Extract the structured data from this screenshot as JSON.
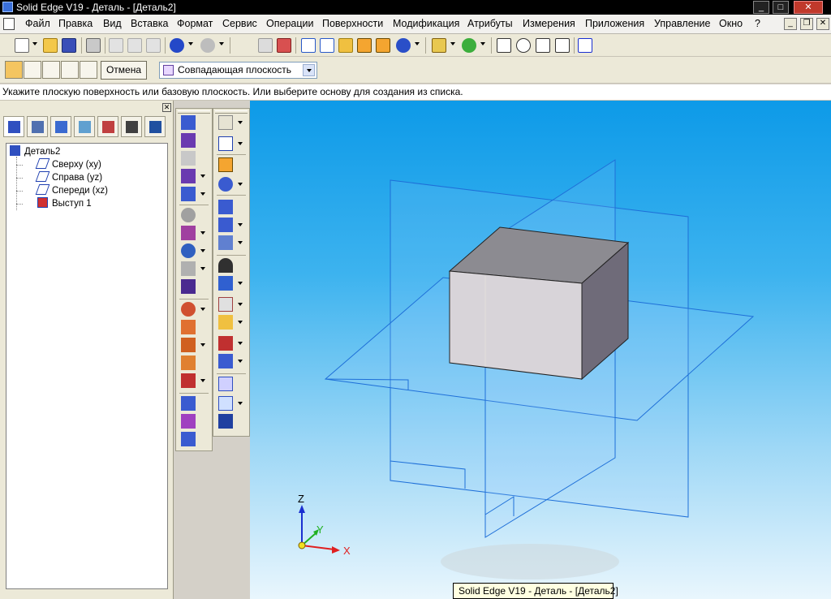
{
  "window": {
    "title": "Solid Edge V19 - Деталь - [Деталь2]",
    "minimize_glyph": "_",
    "restore_glyph": "□",
    "close_glyph": "✕"
  },
  "menu": {
    "items": [
      "Файл",
      "Правка",
      "Вид",
      "Вставка",
      "Формат",
      "Сервис",
      "Операции",
      "Поверхности",
      "Модификация",
      "Атрибуты",
      "Измерения",
      "Приложения",
      "Управление",
      "Окно",
      "?"
    ]
  },
  "toolbar2": {
    "cancel_label": "Отмена",
    "plane_option": "Совпадающая плоскость"
  },
  "prompt": {
    "text": "Укажите плоскую поверхность или базовую плоскость.  Или выберите основу для создания из списка."
  },
  "tree": {
    "root": "Деталь2",
    "items": [
      "Сверху (xy)",
      "Справа (yz)",
      "Спереди (xz)",
      "Выступ 1"
    ]
  },
  "axes": {
    "x": "X",
    "y": "Y",
    "z": "Z"
  },
  "status_tooltip": "Solid Edge V19 - Деталь - [Деталь2]",
  "colors": {
    "viewport_top": "#0d9ae8",
    "viewport_bottom": "#e9f6fd",
    "plane_lines": "#1e6fd8",
    "axis_x": "#e02020",
    "axis_y": "#20b020",
    "axis_z": "#1a2fd0",
    "selected_tool": "#f4c560"
  },
  "icons": {
    "toolbar1": [
      "new-icon",
      "open-icon",
      "save-icon",
      "print-icon",
      "cut-icon",
      "copy-icon",
      "paste-icon",
      "undo-icon",
      "redo-icon",
      "insert-icon",
      "zoom-icon",
      "view-iso-icon",
      "view-shade-icon",
      "sphere-icon",
      "layer-icon",
      "select-icon",
      "zoom-area-icon",
      "zoom-icon-2",
      "fit-icon",
      "pan-icon",
      "help-icon"
    ]
  }
}
